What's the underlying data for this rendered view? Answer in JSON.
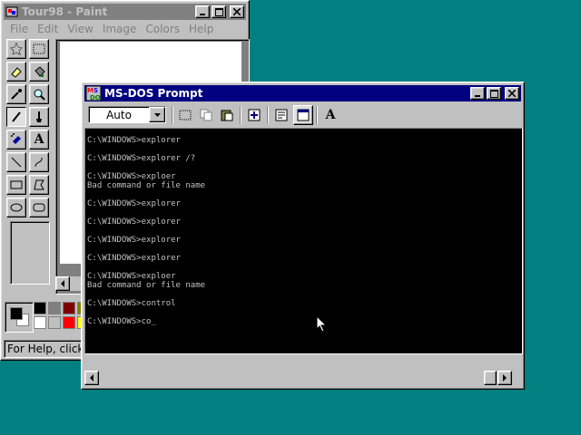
{
  "paint": {
    "title": "Tour98 - Paint",
    "menu": [
      "File",
      "Edit",
      "View",
      "Image",
      "Colors",
      "Help"
    ],
    "status": "For Help, click He",
    "palette_colors": [
      "#000000",
      "#808080",
      "#800000",
      "#808000",
      "#ffffff",
      "#c0c0c0",
      "#ff0000",
      "#ffff00"
    ]
  },
  "dos": {
    "title": "MS-DOS Prompt",
    "font_select": "Auto",
    "console_lines": [
      "C:\\WINDOWS>explorer",
      "",
      "C:\\WINDOWS>explorer /?",
      "",
      "C:\\WINDOWS>exploer",
      "Bad command or file name",
      "",
      "C:\\WINDOWS>explorer",
      "",
      "C:\\WINDOWS>explorer",
      "",
      "C:\\WINDOWS>explorer",
      "",
      "C:\\WINDOWS>explorer",
      "",
      "C:\\WINDOWS>exploer",
      "Bad command or file name",
      "",
      "C:\\WINDOWS>control",
      "",
      "C:\\WINDOWS>co_"
    ]
  },
  "colors": {
    "desktop": "#008080",
    "active_title": "#000080",
    "inactive_title": "#808080"
  }
}
